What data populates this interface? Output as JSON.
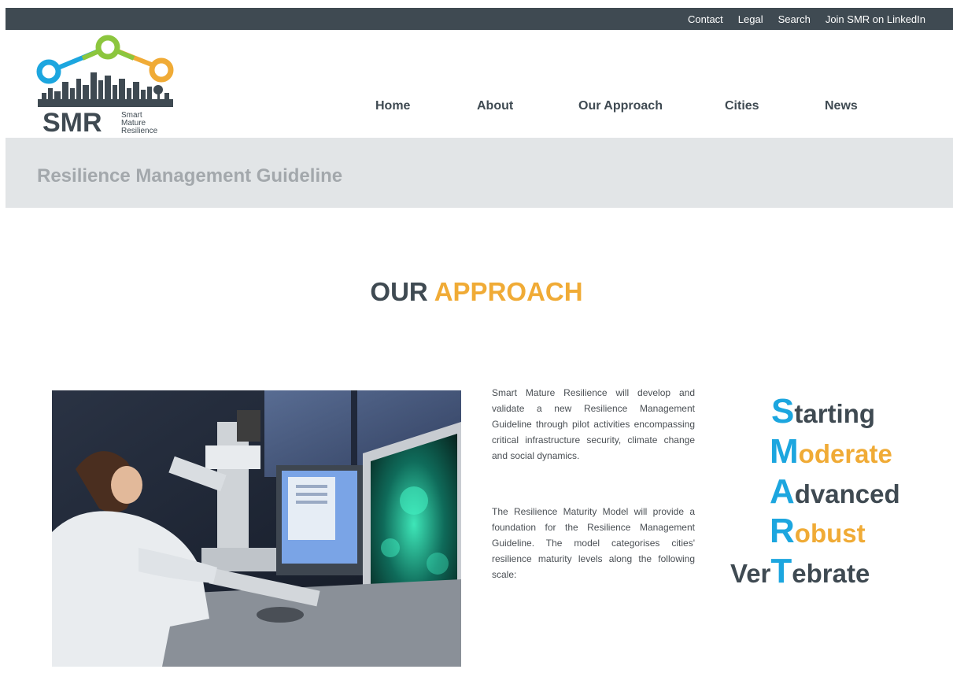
{
  "top_links": [
    "Contact",
    "Legal",
    "Search",
    "Join SMR on LinkedIn"
  ],
  "logo": {
    "abbr": "SMR",
    "subtitle": [
      "Smart",
      "Mature",
      "Resilience"
    ]
  },
  "nav": [
    "Home",
    "About",
    "Our Approach",
    "Cities",
    "News"
  ],
  "page_title": "Resilience Management Guideline",
  "section": {
    "heading_part1": "OUR",
    "heading_part2": "APPROACH"
  },
  "paragraphs": [
    "Smart Mature Resilience will develop and validate a new Resilience Management Guideline through pilot activities encompassing critical infrastructure security, climate change and social dynamics.",
    "The Resilience Maturity Model will provide a foundation for the Resilience Management Guideline. The model categorises cities' resilience maturity levels along the following scale:"
  ],
  "scale": [
    {
      "pre": "",
      "initial": "S",
      "rest": "tarting"
    },
    {
      "pre": "",
      "initial": "M",
      "rest": "oderate"
    },
    {
      "pre": "",
      "initial": "A",
      "rest": "dvanced"
    },
    {
      "pre": "",
      "initial": "R",
      "rest": "obust"
    },
    {
      "pre": "Ver",
      "initial": "T",
      "rest": "ebrate"
    }
  ],
  "colors": {
    "dark": "#3f4a52",
    "accent_orange": "#f0ab36",
    "accent_blue": "#1ca6df",
    "accent_green": "#8cc63e"
  }
}
